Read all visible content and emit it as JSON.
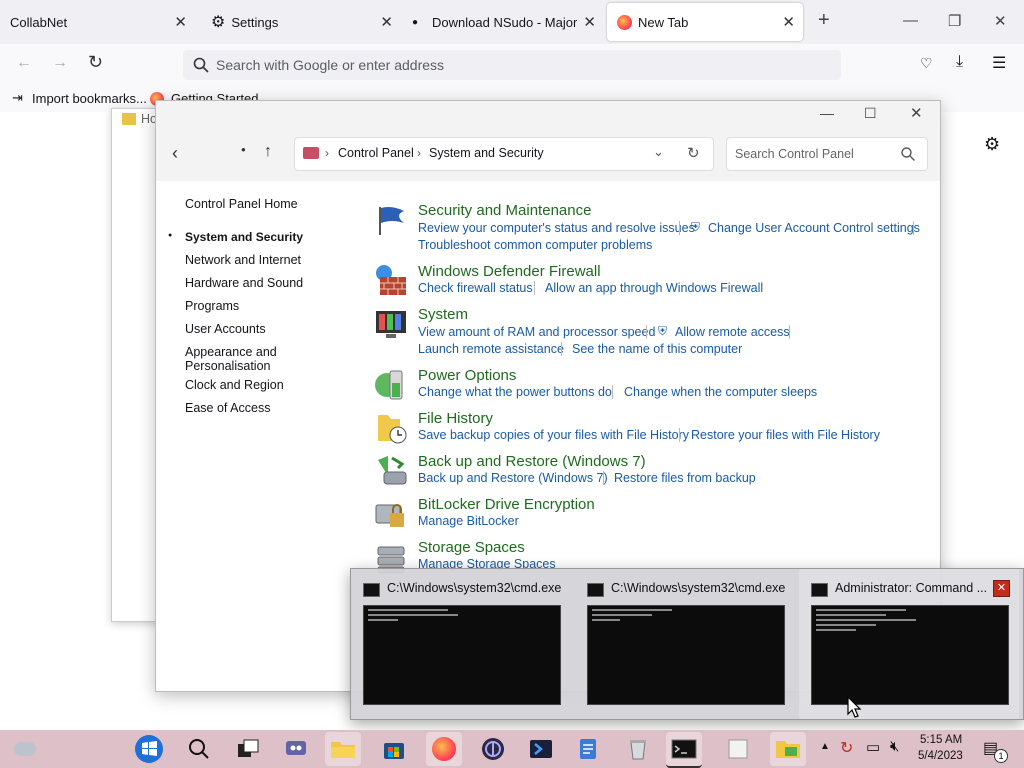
{
  "browser": {
    "tabs": [
      {
        "label": "CollabNet"
      },
      {
        "label": "Settings"
      },
      {
        "label": "Download NSudo - MajorGeeks"
      },
      {
        "label": "New Tab"
      }
    ],
    "url_placeholder": "Search with Google or enter address",
    "bookmarks": [
      {
        "label": "Import bookmarks..."
      },
      {
        "label": "Getting Started"
      }
    ]
  },
  "back_window": {
    "title": "Ho"
  },
  "control_panel": {
    "breadcrumb": [
      "Control Panel",
      "System and Security"
    ],
    "search_placeholder": "Search Control Panel",
    "sidebar": [
      {
        "label": "Control Panel Home"
      },
      {
        "label": "System and Security"
      },
      {
        "label": "Network and Internet"
      },
      {
        "label": "Hardware and Sound"
      },
      {
        "label": "Programs"
      },
      {
        "label": "User Accounts"
      },
      {
        "label": "Appearance and Personalisation"
      },
      {
        "label": "Clock and Region"
      },
      {
        "label": "Ease of Access"
      }
    ],
    "categories": [
      {
        "title": "Security and Maintenance",
        "icon": "flag-icon",
        "links": [
          "Review your computer's status and resolve issues",
          "Change User Account Control settings",
          "Troubleshoot common computer problems"
        ]
      },
      {
        "title": "Windows Defender Firewall",
        "icon": "firewall-icon",
        "links": [
          "Check firewall status",
          "Allow an app through Windows Firewall"
        ]
      },
      {
        "title": "System",
        "icon": "system-icon",
        "links": [
          "View amount of RAM and processor speed",
          "Allow remote access",
          "Launch remote assistance",
          "See the name of this computer"
        ]
      },
      {
        "title": "Power Options",
        "icon": "battery-icon",
        "links": [
          "Change what the power buttons do",
          "Change when the computer sleeps"
        ]
      },
      {
        "title": "File History",
        "icon": "folder-clock-icon",
        "links": [
          "Save backup copies of your files with File History",
          "Restore your files with File History"
        ]
      },
      {
        "title": "Back up and Restore (Windows 7)",
        "icon": "backup-icon",
        "links": [
          "Back up and Restore (Windows 7)",
          "Restore files from backup"
        ]
      },
      {
        "title": "BitLocker Drive Encryption",
        "icon": "bitlocker-icon",
        "links": [
          "Manage BitLocker"
        ]
      },
      {
        "title": "Storage Spaces",
        "icon": "storage-icon",
        "links": [
          "Manage Storage Spaces"
        ]
      }
    ]
  },
  "taskbar_preview": [
    {
      "title": "C:\\Windows\\system32\\cmd.exe"
    },
    {
      "title": "C:\\Windows\\system32\\cmd.exe"
    },
    {
      "title": "Administrator: Command ..."
    }
  ],
  "tray": {
    "time": "5:15 AM",
    "date": "5/4/2023",
    "notification_count": "1"
  },
  "colors": {
    "taskbar": "#dec0c8",
    "link": "#1a5aa8",
    "category": "#1e6b1e"
  }
}
